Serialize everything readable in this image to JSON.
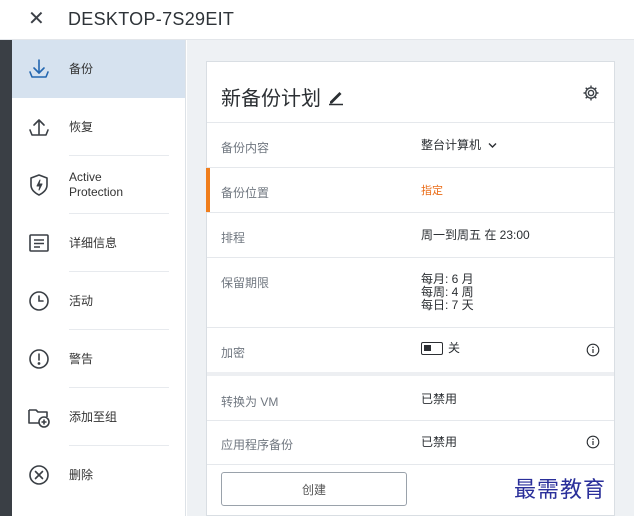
{
  "header": {
    "close_glyph": "✕",
    "title": "DESKTOP-7S29EIT"
  },
  "sidebar": {
    "items": [
      {
        "label": "备份",
        "icon": "backup-download-icon",
        "active": true
      },
      {
        "label": "恢复",
        "icon": "recover-upload-icon"
      },
      {
        "label": "Active Protection",
        "icon": "shield-bolt-icon"
      },
      {
        "label": "详细信息",
        "icon": "details-list-icon"
      },
      {
        "label": "活动",
        "icon": "clock-icon"
      },
      {
        "label": "警告",
        "icon": "alert-icon"
      },
      {
        "label": "添加至组",
        "icon": "folder-add-icon"
      },
      {
        "label": "删除",
        "icon": "delete-x-icon"
      }
    ]
  },
  "plan": {
    "title": "新备份计划",
    "rows": {
      "content": {
        "key": "备份内容",
        "value": "整台计算机",
        "dropdown_glyph": "⌄"
      },
      "location": {
        "key": "备份位置",
        "value": "指定"
      },
      "schedule": {
        "key": "排程",
        "value": "周一到周五 在 23:00"
      },
      "retention": {
        "key": "保留期限",
        "values": [
          "每月: 6 月",
          "每周: 4 周",
          "每日: 7 天"
        ]
      },
      "encryption": {
        "key": "加密",
        "toggle_label": "关"
      },
      "convert_vm": {
        "key": "转换为 VM",
        "value": "已禁用"
      },
      "app_backup": {
        "key": "应用程序备份",
        "value": "已禁用"
      }
    },
    "create_button": "创建"
  },
  "watermark": "最需教育",
  "colors": {
    "accent_orange": "#f07e1c",
    "active_bg": "#d6e2ef",
    "icon_blue": "#2467b0"
  }
}
